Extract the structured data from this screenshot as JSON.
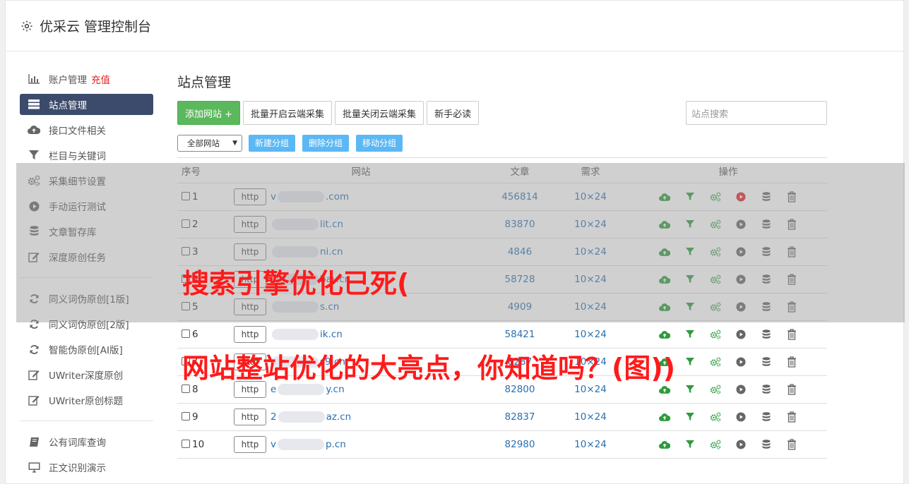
{
  "header": {
    "title": "优采云 管理控制台"
  },
  "sidebar": {
    "items": [
      {
        "label": "账户管理",
        "extra": "充值",
        "icon": "bar-chart-icon"
      },
      {
        "label": "站点管理",
        "icon": "server-icon"
      },
      {
        "label": "接口文件相关",
        "icon": "cloud-upload-icon"
      },
      {
        "label": "栏目与关键词",
        "icon": "filter-icon"
      },
      {
        "label": "采集细节设置",
        "icon": "gears-icon"
      },
      {
        "label": "手动运行测试",
        "icon": "play-icon"
      },
      {
        "label": "文章暂存库",
        "icon": "database-icon"
      },
      {
        "label": "深度原创任务",
        "icon": "edit-icon"
      },
      {
        "label": "同义词伪原创[1版]",
        "icon": "refresh-icon"
      },
      {
        "label": "同义词伪原创[2版]",
        "icon": "refresh-icon"
      },
      {
        "label": "智能伪原创[AI版]",
        "icon": "refresh-icon"
      },
      {
        "label": "UWriter深度原创",
        "icon": "edit-icon"
      },
      {
        "label": "UWriter原创标题",
        "icon": "edit-icon"
      },
      {
        "label": "公有词库查询",
        "icon": "book-icon"
      },
      {
        "label": "正文识别演示",
        "icon": "monitor-icon"
      }
    ]
  },
  "main": {
    "title": "站点管理",
    "buttons": {
      "add_site": "添加网站 +",
      "batch_open": "批量开启云端采集",
      "batch_close": "批量关闭云端采集",
      "guide": "新手必读"
    },
    "search_placeholder": "站点搜索",
    "group_select": "全部网站",
    "group_buttons": {
      "new": "新建分组",
      "delete": "删除分组",
      "move": "移动分组"
    },
    "table": {
      "headers": {
        "no": "序号",
        "site": "网站",
        "articles": "文章",
        "demand": "需求",
        "ops": "操作"
      },
      "rows": [
        {
          "no": "1",
          "protocol": "http",
          "pre": "v",
          "domain": ".com",
          "articles": "456814",
          "demand": "10×24",
          "running": true
        },
        {
          "no": "2",
          "protocol": "http",
          "pre": "",
          "domain": "lit.cn",
          "articles": "83870",
          "demand": "10×24",
          "running": false
        },
        {
          "no": "3",
          "protocol": "http",
          "pre": "",
          "domain": "ni.cn",
          "articles": "4846",
          "demand": "10×24",
          "running": false
        },
        {
          "no": "4",
          "protocol": "http",
          "pre": "",
          "domain": "bay.cn",
          "articles": "58728",
          "demand": "10×24",
          "running": false
        },
        {
          "no": "5",
          "protocol": "http",
          "pre": "",
          "domain": "s.cn",
          "articles": "4909",
          "demand": "10×24",
          "running": false
        },
        {
          "no": "6",
          "protocol": "http",
          "pre": "",
          "domain": "ik.cn",
          "articles": "58421",
          "demand": "10×24",
          "running": false
        },
        {
          "no": "7",
          "protocol": "http",
          "pre": "",
          "domain": "s9.cn",
          "articles": "8287",
          "demand": "10×24",
          "running": false
        },
        {
          "no": "8",
          "protocol": "http",
          "pre": "e",
          "domain": "y.cn",
          "articles": "82800",
          "demand": "10×24",
          "running": false
        },
        {
          "no": "9",
          "protocol": "http",
          "pre": "2",
          "domain": "az.cn",
          "articles": "82837",
          "demand": "10×24",
          "running": false
        },
        {
          "no": "10",
          "protocol": "http",
          "pre": "v",
          "domain": "p.cn",
          "articles": "82980",
          "demand": "10×24",
          "running": false
        }
      ]
    }
  },
  "overlay": {
    "line1": "搜索引擎优化已死(",
    "line2": "网站整站优化的大亮点，你知道吗？(图))"
  },
  "colors": {
    "accent_green": "#5cb85c",
    "nav_active": "#3c4b6b",
    "link_blue": "#2a6fb0",
    "overlay_red": "#ff1a1a"
  }
}
